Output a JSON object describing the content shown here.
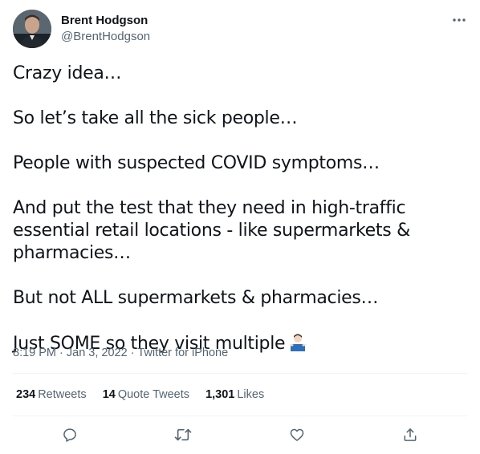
{
  "author": {
    "name": "Brent Hodgson",
    "handle": "@BrentHodgson",
    "avatar_icon": "profile-photo"
  },
  "more_icon": "more-dots-icon",
  "tweet": {
    "paragraphs": [
      "Crazy idea…",
      "So let’s take all the sick people…",
      "People with suspected COVID symptoms…",
      "And put the test that they need in high-traffic essential retail locations - like supermarkets & pharmacies…",
      "But not ALL supermarkets & pharmacies…",
      "Just SOME so they visit multiple"
    ],
    "emoji": "man-shrugging-emoji"
  },
  "meta": {
    "time": "8:19 PM",
    "separator": " · ",
    "date": "Jan 3, 2022",
    "source": "Twitter for iPhone"
  },
  "stats": {
    "retweets_count": "234",
    "retweets_label": "Retweets",
    "quotes_count": "14",
    "quotes_label": "Quote Tweets",
    "likes_count": "1,301",
    "likes_label": "Likes"
  },
  "actions": [
    "reply-icon",
    "retweet-icon",
    "like-icon",
    "share-icon"
  ],
  "colors": {
    "text": "#0f1419",
    "secondary": "#536471",
    "divider": "#eff3f4"
  }
}
